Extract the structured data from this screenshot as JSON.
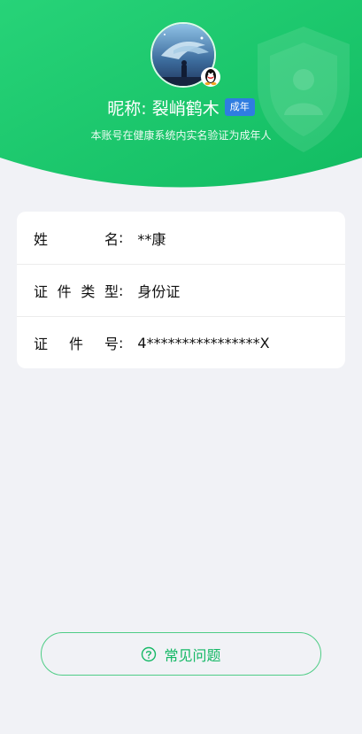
{
  "profile": {
    "nickname_label": "昵称:",
    "nickname": "裂峭鹤木",
    "adult_badge": "成年",
    "verify_note": "本账号在健康系统内实名验证为成年人"
  },
  "info_rows": [
    {
      "label_chars": [
        "姓",
        "名"
      ],
      "value": "**康"
    },
    {
      "label_chars": [
        "证",
        "件",
        "类",
        "型"
      ],
      "value": "身份证"
    },
    {
      "label_chars": [
        "证",
        "件",
        "号"
      ],
      "value": "4****************X"
    }
  ],
  "colon": ":",
  "faq": {
    "label": "常见问题"
  },
  "colors": {
    "brand_green": "#1fc76f",
    "accent_blue": "#2f7de1",
    "background": "#f1f2f6"
  },
  "icons": [
    "shield-user-icon",
    "avatar",
    "qq-penguin-icon",
    "question-circle-icon"
  ]
}
